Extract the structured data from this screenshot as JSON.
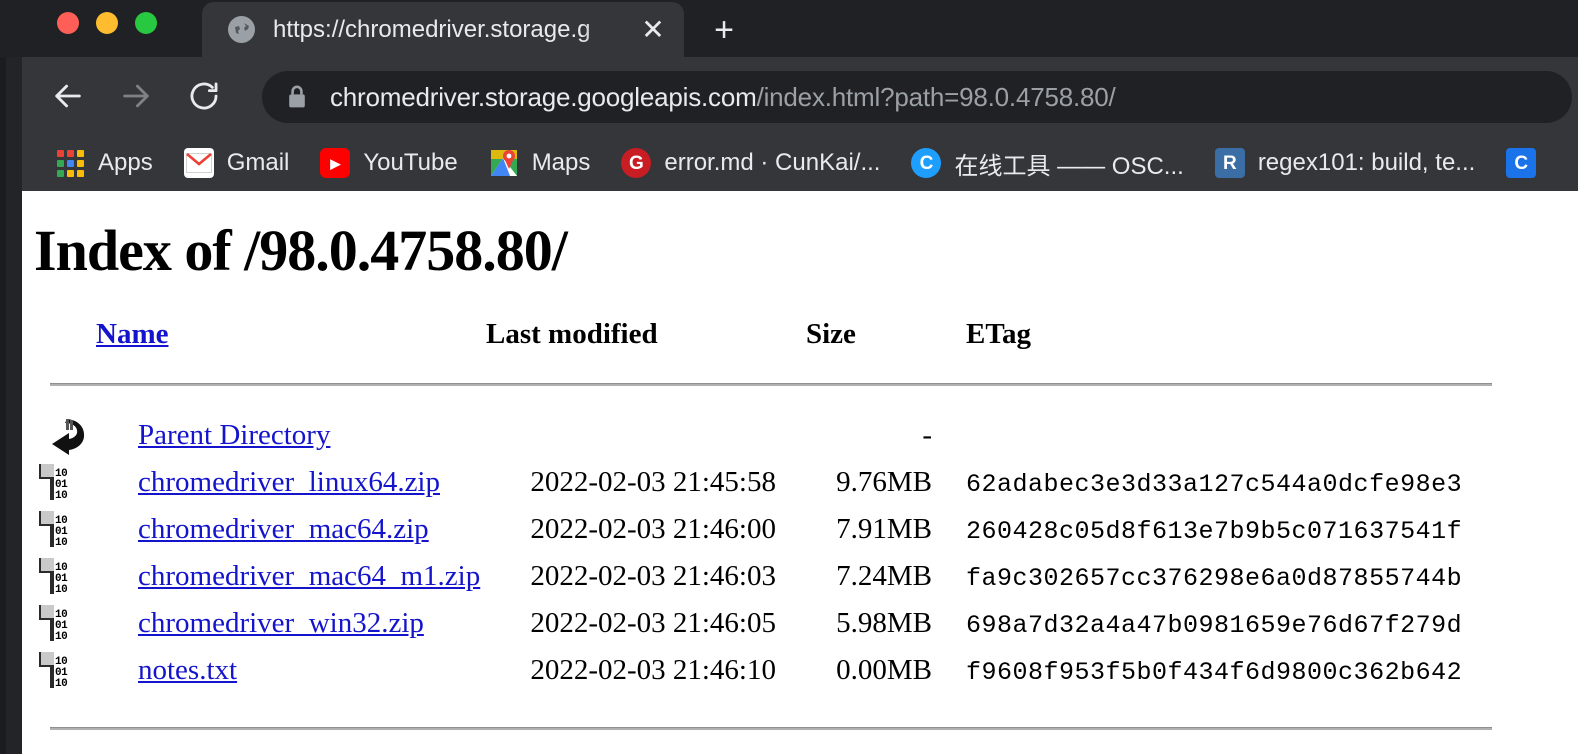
{
  "browser": {
    "window_controls": [
      "close",
      "minimize",
      "maximize"
    ],
    "tab": {
      "title": "https://chromedriver.storage.g",
      "favicon": "globe-icon",
      "close_label": "✕"
    },
    "new_tab_label": "+",
    "nav": {
      "back": "back-arrow",
      "forward": "forward-arrow",
      "reload": "reload-icon"
    },
    "omnibox": {
      "lock": "lock-icon",
      "url_domain": "chromedriver.storage.googleapis.com",
      "url_path": "/index.html?path=98.0.4758.80/"
    },
    "bookmarks": [
      {
        "label": "Apps",
        "icon": "apps-grid-icon",
        "icon_text": "",
        "icon_bg": ""
      },
      {
        "label": "Gmail",
        "icon": "gmail-icon",
        "icon_text": "M",
        "icon_bg": "#ffffff"
      },
      {
        "label": "YouTube",
        "icon": "youtube-icon",
        "icon_text": "▶",
        "icon_bg": "#ff0000"
      },
      {
        "label": "Maps",
        "icon": "maps-icon",
        "icon_text": "",
        "icon_bg": "#34a853"
      },
      {
        "label": "error.md · CunKai/...",
        "icon": "gitee-icon",
        "icon_text": "G",
        "icon_bg": "#c71d23"
      },
      {
        "label": "在线工具 —— OSC...",
        "icon": "oschina-icon",
        "icon_text": "C",
        "icon_bg": "#1e9fff"
      },
      {
        "label": "regex101: build, te...",
        "icon": "regex101-icon",
        "icon_text": "R",
        "icon_bg": "#3a6ea5"
      },
      {
        "label": "",
        "icon": "partial-bookmark-icon",
        "icon_text": "C",
        "icon_bg": "#1a73e8"
      }
    ]
  },
  "page": {
    "heading": "Index of /98.0.4758.80/",
    "columns": {
      "name": "Name",
      "last_modified": "Last modified",
      "size": "Size",
      "etag": "ETag"
    },
    "parent_directory": {
      "icon": "back-arrow-icon",
      "name": "Parent Directory",
      "last_modified": "",
      "size": "-",
      "etag": ""
    },
    "rows": [
      {
        "icon": "binary-file-icon",
        "name": "chromedriver_linux64.zip",
        "last_modified": "2022-02-03 21:45:58",
        "size": "9.76MB",
        "etag": "62adabec3e3d33a127c544a0dcfe98e3"
      },
      {
        "icon": "binary-file-icon",
        "name": "chromedriver_mac64.zip",
        "last_modified": "2022-02-03 21:46:00",
        "size": "7.91MB",
        "etag": "260428c05d8f613e7b9b5c071637541f"
      },
      {
        "icon": "binary-file-icon",
        "name": "chromedriver_mac64_m1.zip",
        "last_modified": "2022-02-03 21:46:03",
        "size": "7.24MB",
        "etag": "fa9c302657cc376298e6a0d87855744b"
      },
      {
        "icon": "binary-file-icon",
        "name": "chromedriver_win32.zip",
        "last_modified": "2022-02-03 21:46:05",
        "size": "5.98MB",
        "etag": "698a7d32a4a47b0981659e76d67f279d"
      },
      {
        "icon": "binary-file-icon",
        "name": "notes.txt",
        "last_modified": "2022-02-03 21:46:10",
        "size": "0.00MB",
        "etag": "f9608f953f5b0f434f6d9800c362b642"
      }
    ]
  },
  "colors": {
    "chrome_bg": "#202124",
    "toolbar_bg": "#35363a",
    "link": "#1414cc",
    "text_light": "#e8eaed",
    "text_dim": "#9aa0a6"
  }
}
